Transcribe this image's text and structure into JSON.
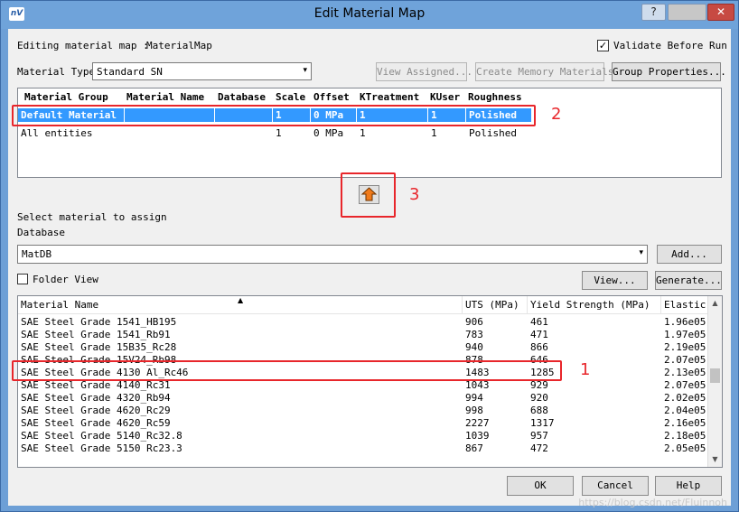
{
  "window": {
    "title": "Edit Material Map",
    "icon_text": "nV",
    "help_btn": "?",
    "close_btn": "✕"
  },
  "header": {
    "editing_label": "Editing material map :",
    "map_name": "MaterialMap",
    "validate_label": "Validate Before Run",
    "validate_checked": true,
    "validate_mark": "✓"
  },
  "material_type": {
    "label": "Material Type",
    "value": "Standard SN",
    "arrow": "▾"
  },
  "top_buttons": {
    "view_assigned": "View Assigned...",
    "create_memory": "Create Memory Materials",
    "group_properties": "Group Properties..."
  },
  "group_table": {
    "columns": [
      "Material Group",
      "Material Name",
      "Database",
      "Scale",
      "Offset",
      "KTreatment",
      "KUser",
      "Roughness"
    ],
    "rows": [
      [
        "Default Material",
        "",
        "",
        "1",
        "0 MPa",
        "1",
        "1",
        "Polished"
      ],
      [
        "All entities",
        "",
        "",
        "1",
        "0 MPa",
        "1",
        "1",
        "Polished"
      ]
    ]
  },
  "annotations": {
    "one": "1",
    "two": "2",
    "three": "3"
  },
  "assign": {
    "select_label": "Select material to assign",
    "database_label": "Database",
    "database_value": "MatDB",
    "database_arrow": "▾",
    "add_button": "Add...",
    "folder_view_label": "Folder View",
    "view_button": "View...",
    "generate_button": "Generate...",
    "sort_indicator": "▲"
  },
  "material_list": {
    "columns": [
      "Material Name",
      "UTS (MPa)",
      "Yield Strength (MPa)",
      "Elastic"
    ],
    "rows": [
      [
        "SAE Steel Grade 1541_HB195",
        "906",
        "461",
        "1.96e05"
      ],
      [
        "SAE Steel Grade 1541_Rb91",
        "783",
        "471",
        "1.97e05"
      ],
      [
        "SAE Steel Grade 15B35_Rc28",
        "940",
        "866",
        "2.19e05"
      ],
      [
        "SAE Steel Grade 15V24_Rb98",
        "878",
        "646",
        "2.07e05"
      ],
      [
        "SAE Steel Grade 4130 Al_Rc46",
        "1483",
        "1285",
        "2.13e05"
      ],
      [
        "SAE Steel Grade 4140_Rc31",
        "1043",
        "929",
        "2.07e05"
      ],
      [
        "SAE Steel Grade 4320_Rb94",
        "994",
        "920",
        "2.02e05"
      ],
      [
        "SAE Steel Grade 4620_Rc29",
        "998",
        "688",
        "2.04e05"
      ],
      [
        "SAE Steel Grade 4620_Rc59",
        "2227",
        "1317",
        "2.16e05"
      ],
      [
        "SAE Steel Grade 5140_Rc32.8",
        "1039",
        "957",
        "2.18e05"
      ],
      [
        "SAE Steel Grade 5150 Rc23.3",
        "867",
        "472",
        "2.05e05"
      ]
    ]
  },
  "footer": {
    "ok": "OK",
    "cancel": "Cancel",
    "help": "Help",
    "watermark": "https://blog.csdn.net/Fluinnoh"
  }
}
